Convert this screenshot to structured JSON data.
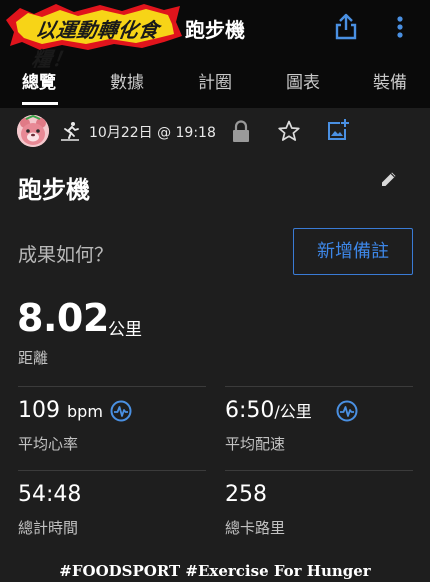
{
  "header": {
    "logo_text": "以運動轉化食糧！",
    "title": "跑步機",
    "share_icon": "share-icon",
    "more_icon": "more-vert-icon"
  },
  "tabs": [
    {
      "label": "總覽",
      "active": true
    },
    {
      "label": "數據",
      "active": false
    },
    {
      "label": "計圈",
      "active": false
    },
    {
      "label": "圖表",
      "active": false
    },
    {
      "label": "裝備",
      "active": false
    }
  ],
  "meta": {
    "avatar_icon": "bear-avatar",
    "activity_icon": "treadmill-run-icon",
    "date": "10月22日 @ 19:18",
    "lock_icon": "lock-icon",
    "star_icon": "star-outline-icon",
    "add_photo_icon": "add-photo-icon"
  },
  "activity": {
    "title": "跑步機",
    "edit_icon": "pencil-icon"
  },
  "notes": {
    "prompt": "成果如何？",
    "add_note_label": "新增備註"
  },
  "distance": {
    "value": "8.02",
    "unit": "公里",
    "label": "距離"
  },
  "stats": {
    "heart_rate": {
      "value": "109",
      "unit": "bpm",
      "label": "平均心率"
    },
    "pace": {
      "value": "6:50",
      "unit": "/公里",
      "label": "平均配速"
    },
    "time": {
      "value": "54:48",
      "label": "總計時間"
    },
    "calories": {
      "value": "258",
      "label": "總卡路里"
    }
  },
  "footer": {
    "caption": "#FOODSPORT #Exercise For Hunger"
  },
  "colors": {
    "accent_blue": "#3d86e6",
    "background": "#1e1e1e",
    "appbar": "#0a0a0a",
    "logo_red": "#e0141c",
    "logo_yellow": "#f7d417"
  }
}
